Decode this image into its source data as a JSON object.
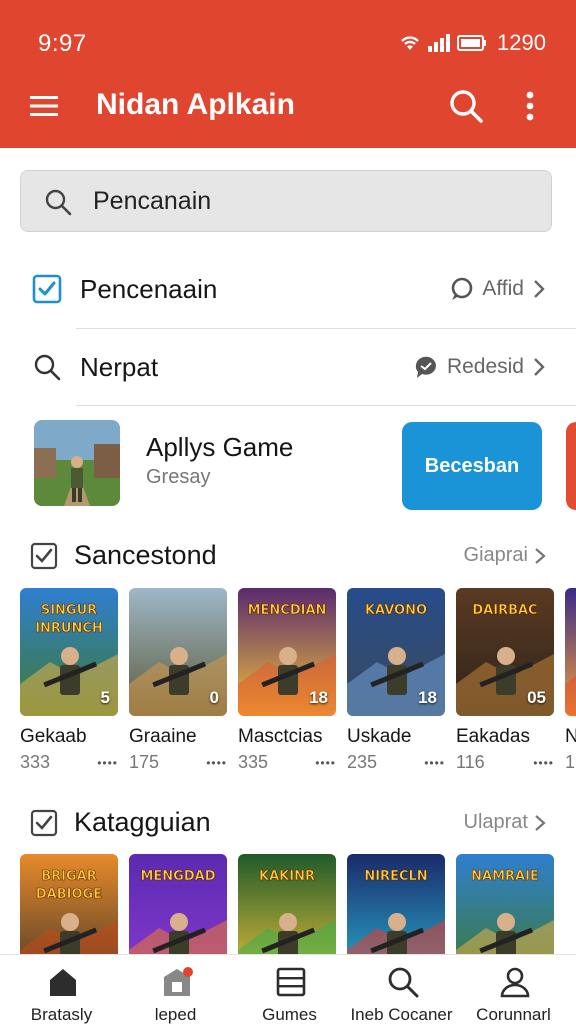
{
  "status_bar": {
    "time": "9:97",
    "battery_text": "1290"
  },
  "app_bar": {
    "title": "Nidan Aplkain"
  },
  "search": {
    "value": "Pencanain"
  },
  "list_rows": [
    {
      "label": "Pencenaain",
      "right_text": "Affid"
    },
    {
      "label": "Nerpat",
      "right_text": "Redesid"
    }
  ],
  "featured": {
    "title": "Apllys Game",
    "subtitle": "Gresay",
    "button_label": "Becesban"
  },
  "sections": [
    {
      "title": "Sancestond",
      "more_label": "Giaprai",
      "items": [
        {
          "name": "Gekaab",
          "count": "333",
          "badge": "5",
          "art_title": "SINGUR INRUNCH"
        },
        {
          "name": "Graaine",
          "count": "175",
          "badge": "0",
          "art_title": ""
        },
        {
          "name": "Masctcias",
          "count": "335",
          "badge": "18",
          "art_title": "MENCDIAN"
        },
        {
          "name": "Uskade",
          "count": "235",
          "badge": "18",
          "art_title": "KAVONO"
        },
        {
          "name": "Eakadas",
          "count": "116",
          "badge": "05",
          "art_title": "DAIRBAC"
        },
        {
          "name": "N",
          "count": "1",
          "badge": "",
          "art_title": ""
        }
      ]
    },
    {
      "title": "Katagguian",
      "more_label": "Ulaprat",
      "items": [
        {
          "name": "",
          "count": "",
          "badge": "",
          "art_title": "BRIGAR DABIOGE"
        },
        {
          "name": "",
          "count": "",
          "badge": "",
          "art_title": "MENGDAD"
        },
        {
          "name": "",
          "count": "",
          "badge": "",
          "art_title": "KAKINR"
        },
        {
          "name": "",
          "count": "",
          "badge": "",
          "art_title": "NIRECLN"
        },
        {
          "name": "",
          "count": "",
          "badge": "",
          "art_title": "NAMRAIE"
        }
      ]
    }
  ],
  "bottom_nav": [
    {
      "label": "Bratasly",
      "icon": "home-icon"
    },
    {
      "label": "leped",
      "icon": "store-icon"
    },
    {
      "label": "Gumes",
      "icon": "list-icon"
    },
    {
      "label": "Ineb Cocaner",
      "icon": "search-icon"
    },
    {
      "label": "Corunnarl",
      "icon": "account-icon"
    }
  ],
  "colors": {
    "app_bar": "#e0452f",
    "accent_button": "#1a94d6",
    "checkbox": "#1f8fd3"
  }
}
